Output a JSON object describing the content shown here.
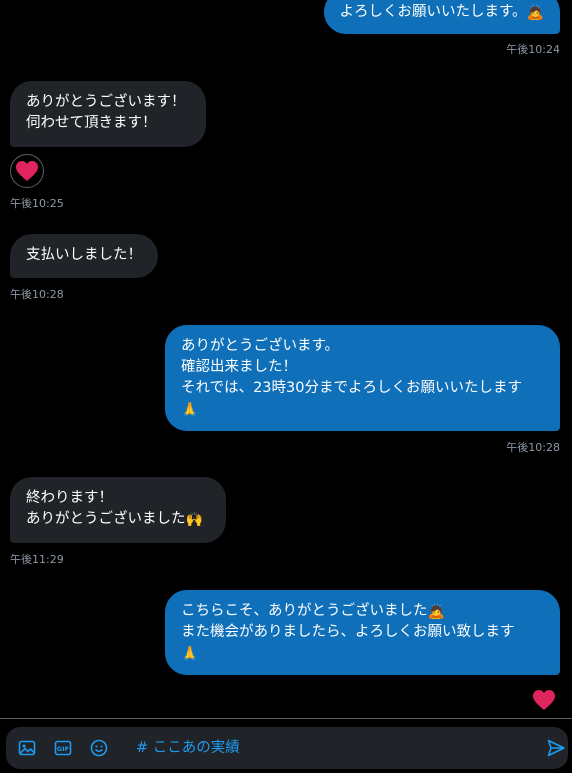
{
  "messages": [
    {
      "side": "sent",
      "lines": [
        "よろしくお願いいたします。"
      ],
      "trailing_emoji": "🙇",
      "time": "午後10:24"
    },
    {
      "side": "recv",
      "lines": [
        "ありがとうございます！",
        "伺わせて頂きます！"
      ],
      "reaction": "heart",
      "time": "午後10:25"
    },
    {
      "side": "recv",
      "lines": [
        "支払いしました！"
      ],
      "time": "午後10:28"
    },
    {
      "side": "sent",
      "lines": [
        "ありがとうございます。",
        "確認出来ました！",
        "それでは、23時30分までよろしくお願いいたします"
      ],
      "emoji_line": "🙏",
      "time": "午後10:28"
    },
    {
      "side": "recv",
      "lines": [
        "終わります！",
        "ありがとうございました"
      ],
      "trailing_emoji": "🙌",
      "time": "午後11:29"
    },
    {
      "side": "sent",
      "lines": [
        "こちらこそ、ありがとうございました",
        "また機会がありましたら、よろしくお願い致します"
      ],
      "line1_emoji": "🙇",
      "emoji_line": "🙏",
      "liked": true
    }
  ],
  "composer": {
    "text": "# ここあの実績",
    "icons": [
      "image-icon",
      "gif-icon",
      "emoji-icon",
      "send-icon"
    ]
  },
  "colors": {
    "sent_bubble": "#0f6fb8",
    "recv_bubble": "#202327",
    "timestamp": "#8b98a5",
    "heart": "#f91880",
    "accent": "#1d9bf0"
  }
}
